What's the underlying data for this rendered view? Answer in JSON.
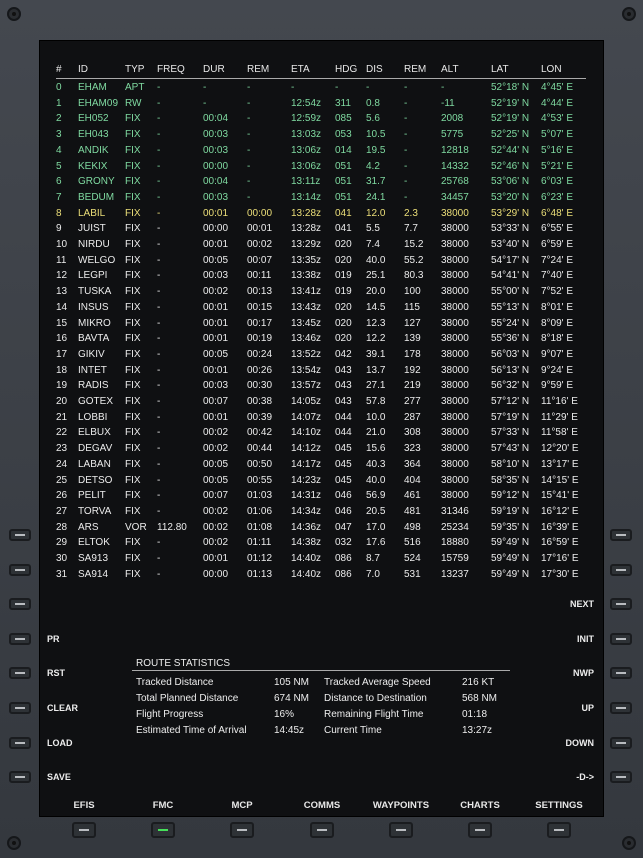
{
  "columns": [
    "#",
    "ID",
    "TYP",
    "FREQ",
    "DUR",
    "REM",
    "ETA",
    "HDG",
    "DIS",
    "REM",
    "ALT",
    "LAT",
    "LON"
  ],
  "rows": [
    {
      "status": "green",
      "cells": [
        "0",
        "EHAM",
        "APT",
        "-",
        "-",
        "-",
        "-",
        "-",
        "-",
        "-",
        "-",
        "52°18' N",
        "4°45' E"
      ]
    },
    {
      "status": "green",
      "cells": [
        "1",
        "EHAM09",
        "RW",
        "-",
        "-",
        "-",
        "12:54z",
        "311",
        "0.8",
        "-",
        "-11",
        "52°19' N",
        "4°44' E"
      ]
    },
    {
      "status": "green",
      "cells": [
        "2",
        "EH052",
        "FIX",
        "-",
        "00:04",
        "-",
        "12:59z",
        "085",
        "5.6",
        "-",
        "2008",
        "52°19' N",
        "4°53' E"
      ]
    },
    {
      "status": "green",
      "cells": [
        "3",
        "EH043",
        "FIX",
        "-",
        "00:03",
        "-",
        "13:03z",
        "053",
        "10.5",
        "-",
        "5775",
        "52°25' N",
        "5°07' E"
      ]
    },
    {
      "status": "green",
      "cells": [
        "4",
        "ANDIK",
        "FIX",
        "-",
        "00:03",
        "-",
        "13:06z",
        "014",
        "19.5",
        "-",
        "12818",
        "52°44' N",
        "5°16' E"
      ]
    },
    {
      "status": "green",
      "cells": [
        "5",
        "KEKIX",
        "FIX",
        "-",
        "00:00",
        "-",
        "13:06z",
        "051",
        "4.2",
        "-",
        "14332",
        "52°46' N",
        "5°21' E"
      ]
    },
    {
      "status": "green",
      "cells": [
        "6",
        "GRONY",
        "FIX",
        "-",
        "00:04",
        "-",
        "13:11z",
        "051",
        "31.7",
        "-",
        "25768",
        "53°06' N",
        "6°03' E"
      ]
    },
    {
      "status": "green",
      "cells": [
        "7",
        "BEDUM",
        "FIX",
        "-",
        "00:03",
        "-",
        "13:14z",
        "051",
        "24.1",
        "-",
        "34457",
        "53°20' N",
        "6°23' E"
      ]
    },
    {
      "status": "cur",
      "cells": [
        "8",
        "LABIL",
        "FIX",
        "-",
        "00:01",
        "00:00",
        "13:28z",
        "041",
        "12.0",
        "2.3",
        "38000",
        "53°29' N",
        "6°48' E"
      ]
    },
    {
      "status": "white",
      "cells": [
        "9",
        "JUIST",
        "FIX",
        "-",
        "00:00",
        "00:01",
        "13:28z",
        "041",
        "5.5",
        "7.7",
        "38000",
        "53°33' N",
        "6°55' E"
      ]
    },
    {
      "status": "white",
      "cells": [
        "10",
        "NIRDU",
        "FIX",
        "-",
        "00:01",
        "00:02",
        "13:29z",
        "020",
        "7.4",
        "15.2",
        "38000",
        "53°40' N",
        "6°59' E"
      ]
    },
    {
      "status": "white",
      "cells": [
        "11",
        "WELGO",
        "FIX",
        "-",
        "00:05",
        "00:07",
        "13:35z",
        "020",
        "40.0",
        "55.2",
        "38000",
        "54°17' N",
        "7°24' E"
      ]
    },
    {
      "status": "white",
      "cells": [
        "12",
        "LEGPI",
        "FIX",
        "-",
        "00:03",
        "00:11",
        "13:38z",
        "019",
        "25.1",
        "80.3",
        "38000",
        "54°41' N",
        "7°40' E"
      ]
    },
    {
      "status": "white",
      "cells": [
        "13",
        "TUSKA",
        "FIX",
        "-",
        "00:02",
        "00:13",
        "13:41z",
        "019",
        "20.0",
        "100",
        "38000",
        "55°00' N",
        "7°52' E"
      ]
    },
    {
      "status": "white",
      "cells": [
        "14",
        "INSUS",
        "FIX",
        "-",
        "00:01",
        "00:15",
        "13:43z",
        "020",
        "14.5",
        "115",
        "38000",
        "55°13' N",
        "8°01' E"
      ]
    },
    {
      "status": "white",
      "cells": [
        "15",
        "MIKRO",
        "FIX",
        "-",
        "00:01",
        "00:17",
        "13:45z",
        "020",
        "12.3",
        "127",
        "38000",
        "55°24' N",
        "8°09' E"
      ]
    },
    {
      "status": "white",
      "cells": [
        "16",
        "BAVTA",
        "FIX",
        "-",
        "00:01",
        "00:19",
        "13:46z",
        "020",
        "12.2",
        "139",
        "38000",
        "55°36' N",
        "8°18' E"
      ]
    },
    {
      "status": "white",
      "cells": [
        "17",
        "GIKIV",
        "FIX",
        "-",
        "00:05",
        "00:24",
        "13:52z",
        "042",
        "39.1",
        "178",
        "38000",
        "56°03' N",
        "9°07' E"
      ]
    },
    {
      "status": "white",
      "cells": [
        "18",
        "INTET",
        "FIX",
        "-",
        "00:01",
        "00:26",
        "13:54z",
        "043",
        "13.7",
        "192",
        "38000",
        "56°13' N",
        "9°24' E"
      ]
    },
    {
      "status": "white",
      "cells": [
        "19",
        "RADIS",
        "FIX",
        "-",
        "00:03",
        "00:30",
        "13:57z",
        "043",
        "27.1",
        "219",
        "38000",
        "56°32' N",
        "9°59' E"
      ]
    },
    {
      "status": "white",
      "cells": [
        "20",
        "GOTEX",
        "FIX",
        "-",
        "00:07",
        "00:38",
        "14:05z",
        "043",
        "57.8",
        "277",
        "38000",
        "57°12' N",
        "11°16' E"
      ]
    },
    {
      "status": "white",
      "cells": [
        "21",
        "LOBBI",
        "FIX",
        "-",
        "00:01",
        "00:39",
        "14:07z",
        "044",
        "10.0",
        "287",
        "38000",
        "57°19' N",
        "11°29' E"
      ]
    },
    {
      "status": "white",
      "cells": [
        "22",
        "ELBUX",
        "FIX",
        "-",
        "00:02",
        "00:42",
        "14:10z",
        "044",
        "21.0",
        "308",
        "38000",
        "57°33' N",
        "11°58' E"
      ]
    },
    {
      "status": "white",
      "cells": [
        "23",
        "DEGAV",
        "FIX",
        "-",
        "00:02",
        "00:44",
        "14:12z",
        "045",
        "15.6",
        "323",
        "38000",
        "57°43' N",
        "12°20' E"
      ]
    },
    {
      "status": "white",
      "cells": [
        "24",
        "LABAN",
        "FIX",
        "-",
        "00:05",
        "00:50",
        "14:17z",
        "045",
        "40.3",
        "364",
        "38000",
        "58°10' N",
        "13°17' E"
      ]
    },
    {
      "status": "white",
      "cells": [
        "25",
        "DETSO",
        "FIX",
        "-",
        "00:05",
        "00:55",
        "14:23z",
        "045",
        "40.0",
        "404",
        "38000",
        "58°35' N",
        "14°15' E"
      ]
    },
    {
      "status": "white",
      "cells": [
        "26",
        "PELIT",
        "FIX",
        "-",
        "00:07",
        "01:03",
        "14:31z",
        "046",
        "56.9",
        "461",
        "38000",
        "59°12' N",
        "15°41' E"
      ]
    },
    {
      "status": "white",
      "cells": [
        "27",
        "TORVA",
        "FIX",
        "-",
        "00:02",
        "01:06",
        "14:34z",
        "046",
        "20.5",
        "481",
        "31346",
        "59°19' N",
        "16°12' E"
      ]
    },
    {
      "status": "white",
      "cells": [
        "28",
        "ARS",
        "VOR",
        "112.80",
        "00:02",
        "01:08",
        "14:36z",
        "047",
        "17.0",
        "498",
        "25234",
        "59°35' N",
        "16°39' E"
      ]
    },
    {
      "status": "white",
      "cells": [
        "29",
        "ELTOK",
        "FIX",
        "-",
        "00:02",
        "01:11",
        "14:38z",
        "032",
        "17.6",
        "516",
        "18880",
        "59°49' N",
        "16°59' E"
      ]
    },
    {
      "status": "white",
      "cells": [
        "30",
        "SA913",
        "FIX",
        "-",
        "00:01",
        "01:12",
        "14:40z",
        "086",
        "8.7",
        "524",
        "15759",
        "59°49' N",
        "17°16' E"
      ]
    },
    {
      "status": "white",
      "cells": [
        "31",
        "SA914",
        "FIX",
        "-",
        "00:00",
        "01:13",
        "14:40z",
        "086",
        "7.0",
        "531",
        "13237",
        "59°49' N",
        "17°30' E"
      ]
    }
  ],
  "stats": {
    "title": "ROUTE STATISTICS",
    "left": [
      {
        "label": "Tracked Distance",
        "value": "105 NM"
      },
      {
        "label": "Total Planned Distance",
        "value": "674 NM"
      },
      {
        "label": "Flight Progress",
        "value": "16%"
      },
      {
        "label": "Estimated Time of Arrival",
        "value": "14:45z"
      }
    ],
    "right": [
      {
        "label": "Tracked Average Speed",
        "value": "216 KT"
      },
      {
        "label": "Distance to Destination",
        "value": "568 NM"
      },
      {
        "label": "Remaining Flight Time",
        "value": "01:18"
      },
      {
        "label": "Current Time",
        "value": "13:27z"
      }
    ]
  },
  "left_keys": [
    "",
    "",
    "",
    "PR",
    "RST",
    "CLEAR",
    "LOAD",
    "SAVE"
  ],
  "right_keys": [
    "",
    "",
    "NEXT",
    "INIT",
    "NWP",
    "UP",
    "DOWN",
    "-D->"
  ],
  "nav": [
    "EFIS",
    "FMC",
    "MCP",
    "COMMS",
    "WAYPOINTS",
    "CHARTS",
    "SETTINGS"
  ],
  "active_nav": "FMC",
  "colors": {
    "active": "#7fd9a0",
    "current": "#ecdf79",
    "pending": "#ececec",
    "led": "#46e05a"
  }
}
